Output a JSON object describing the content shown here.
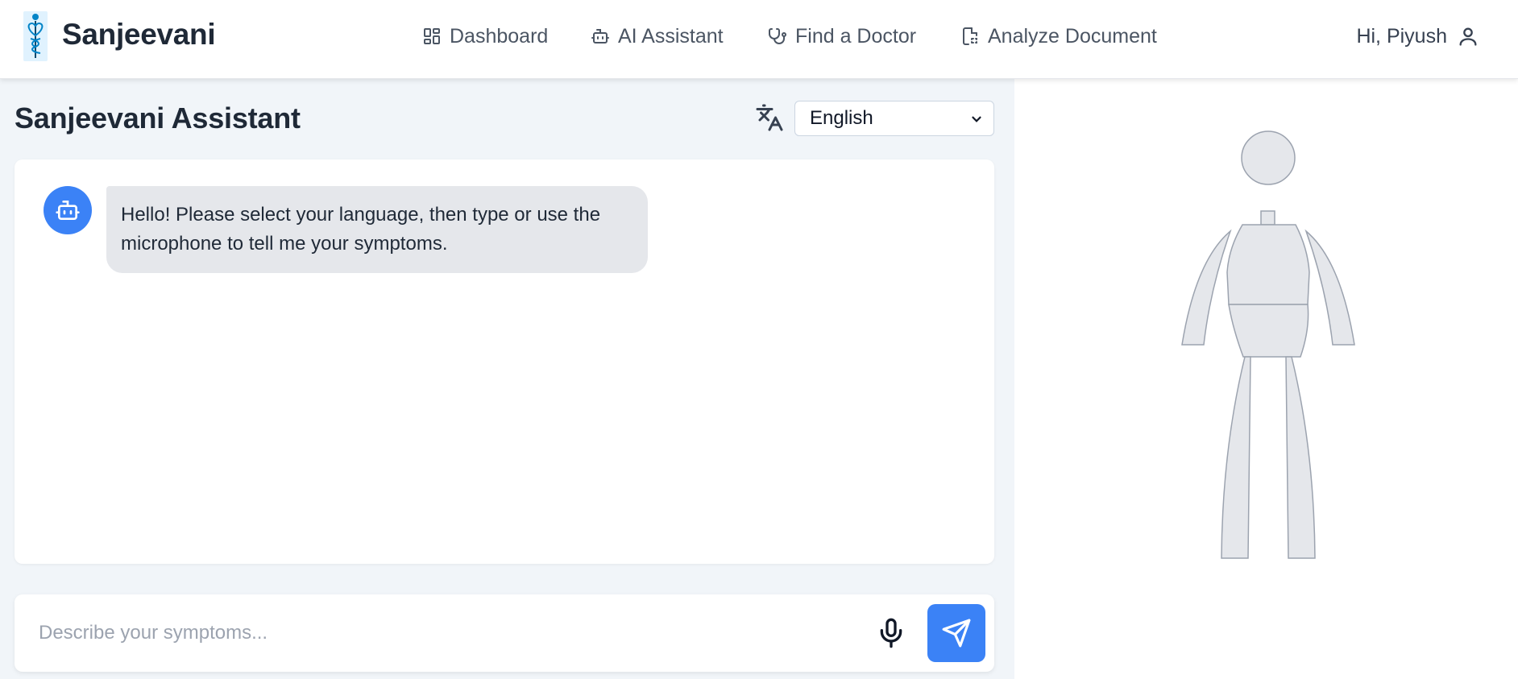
{
  "app": {
    "brand": "Sanjeevani",
    "brand_colors": {
      "accent": "#3b82f6",
      "logo_bg": "#e0f2fe",
      "logo_fg": "#0284c7"
    }
  },
  "nav": {
    "items": [
      {
        "label": "Dashboard",
        "icon": "dashboard-grid-icon"
      },
      {
        "label": "AI Assistant",
        "icon": "bot-icon"
      },
      {
        "label": "Find a Doctor",
        "icon": "stethoscope-icon"
      },
      {
        "label": "Analyze Document",
        "icon": "document-scan-icon"
      }
    ],
    "user_greeting": "Hi, Piyush",
    "user_icon": "user-icon"
  },
  "assistant": {
    "title": "Sanjeevani Assistant",
    "translate_icon": "translate-icon",
    "language": {
      "selected": "English"
    },
    "messages": [
      {
        "sender": "bot",
        "text": "Hello! Please select your language, then type or use the microphone to tell me your symptoms."
      }
    ],
    "composer": {
      "placeholder": "Describe your symptoms...",
      "mic_icon": "microphone-icon",
      "send_icon": "send-icon"
    }
  },
  "body_map": {
    "parts": [
      "head",
      "neck",
      "chest",
      "abdomen",
      "left-arm",
      "right-arm",
      "left-leg",
      "right-leg"
    ],
    "fill": "#e5e7eb",
    "stroke": "#9ca3af"
  }
}
